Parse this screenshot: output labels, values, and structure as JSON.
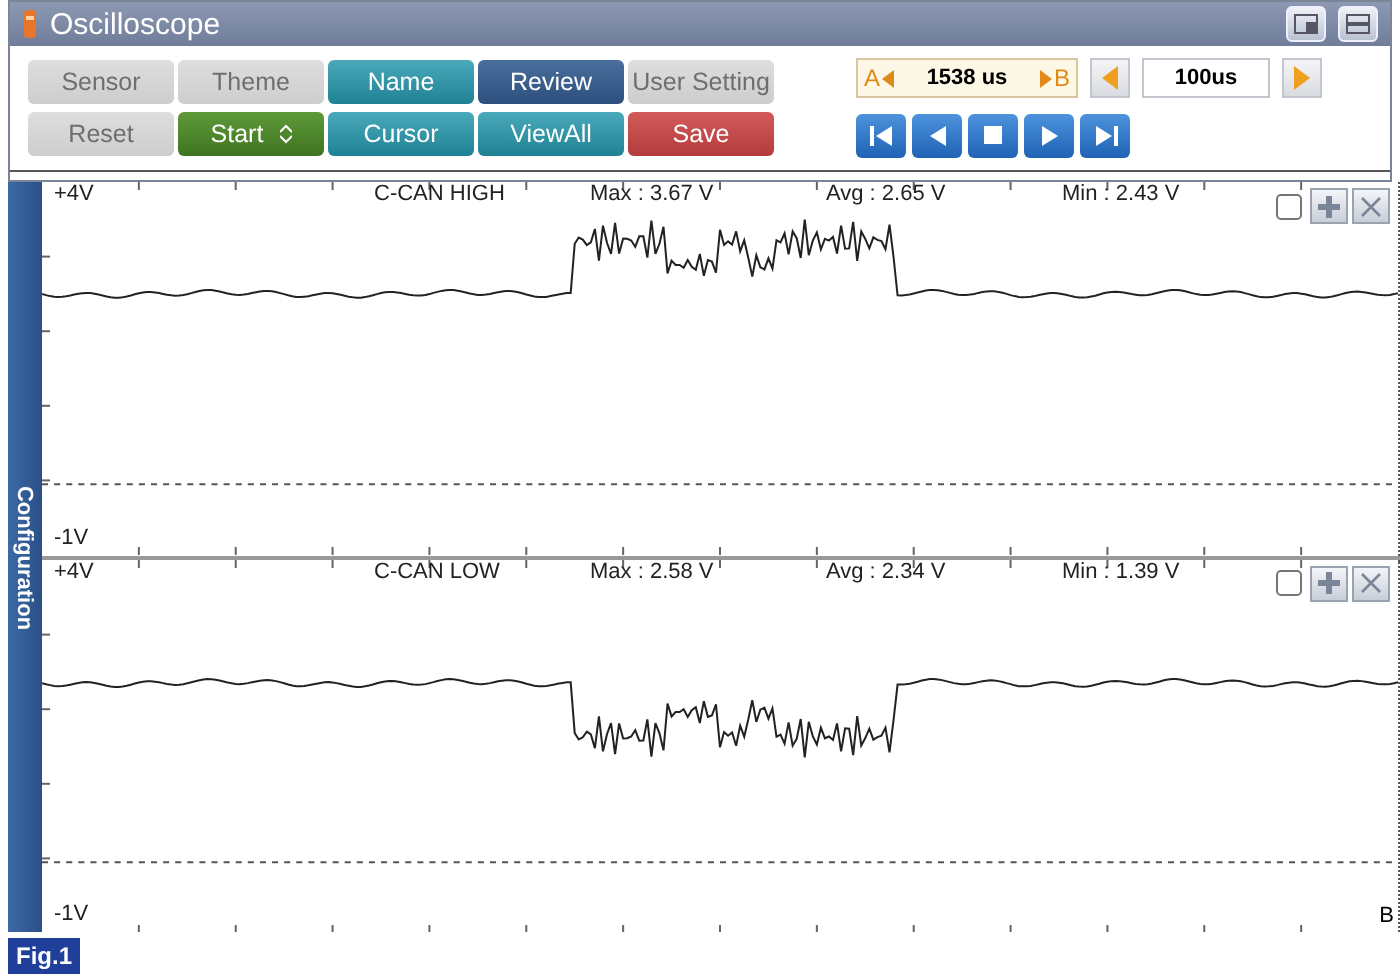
{
  "window": {
    "title": "Oscilloscope"
  },
  "buttons": [
    {
      "label": "Sensor",
      "kind": "disabled"
    },
    {
      "label": "Theme",
      "kind": "disabled"
    },
    {
      "label": "Name",
      "kind": "teal"
    },
    {
      "label": "Review",
      "kind": "navy"
    },
    {
      "label": "User Setting",
      "kind": "disabled"
    },
    {
      "label": "Reset",
      "kind": "disabled"
    },
    {
      "label": "Start",
      "kind": "green"
    },
    {
      "label": "Cursor",
      "kind": "teal"
    },
    {
      "label": "ViewAll",
      "kind": "teal"
    },
    {
      "label": "Save",
      "kind": "red"
    }
  ],
  "cursor": {
    "a_label": "A",
    "reading": "1538 us",
    "b_label": "B"
  },
  "timebase": {
    "value": "100us"
  },
  "side_tab": "Configuration",
  "channels": [
    {
      "top": "+4V",
      "bottom": "-1V",
      "name": "C-CAN HIGH",
      "max": "Max : 3.67 V",
      "avg": "Avg : 2.65 V",
      "min": "Min : 2.43 V",
      "checked": false
    },
    {
      "top": "+4V",
      "bottom": "-1V",
      "name": "C-CAN LOW",
      "max": "Max : 2.58 V",
      "avg": "Avg : 2.34 V",
      "min": "Min : 1.39 V",
      "checked": false,
      "marker": "B"
    }
  ],
  "caption": "Fig.1"
}
